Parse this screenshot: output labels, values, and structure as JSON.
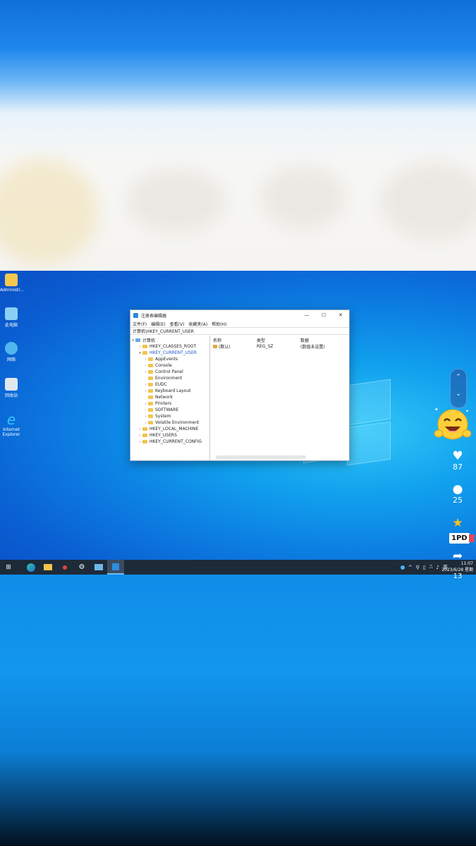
{
  "desktop_icons": [
    {
      "label": "Administr...",
      "icon": "user-folder-icon"
    },
    {
      "label": "此电脑",
      "icon": "computer-icon"
    },
    {
      "label": "网络",
      "icon": "network-icon"
    },
    {
      "label": "回收站",
      "icon": "recycle-bin-icon"
    },
    {
      "label": "Internet Explorer",
      "icon": "ie-icon"
    }
  ],
  "regedit": {
    "title": "注册表编辑器",
    "controls": {
      "minimize": "—",
      "maximize": "☐",
      "close": "✕"
    },
    "menu": [
      "文件(F)",
      "编辑(E)",
      "查看(V)",
      "收藏夹(A)",
      "帮助(H)"
    ],
    "address": "计算机\\HKEY_CURRENT_USER",
    "tree": {
      "root": "计算机",
      "hives_before": [
        "HKEY_CLASSES_ROOT"
      ],
      "selected": "HKEY_CURRENT_USER",
      "children": [
        "AppEvents",
        "Console",
        "Control Panel",
        "Environment",
        "EUDC",
        "Keyboard Layout",
        "Network",
        "Printers",
        "SOFTWARE",
        "System",
        "Volatile Environment"
      ],
      "hives_after": [
        "HKEY_LOCAL_MACHINE",
        "HKEY_USERS",
        "HKEY_CURRENT_CONFIG"
      ]
    },
    "columns": [
      "名称",
      "类型",
      "数据"
    ],
    "rows": [
      {
        "name": "(默认)",
        "type": "REG_SZ",
        "data": "(数值未设置)"
      }
    ]
  },
  "taskbar": {
    "apps": [
      "start-icon",
      "edge-icon",
      "file-explorer-icon",
      "red-dot-app-icon",
      "settings-icon",
      "remote-desktop-icon",
      "regedit-icon"
    ],
    "tray_lang": "英",
    "time": "11:07",
    "date": "2023/6/28 星期"
  },
  "side_overlay": {
    "likes": "87",
    "comments": "25",
    "favorites_tag": "1PD",
    "shares": "13"
  }
}
